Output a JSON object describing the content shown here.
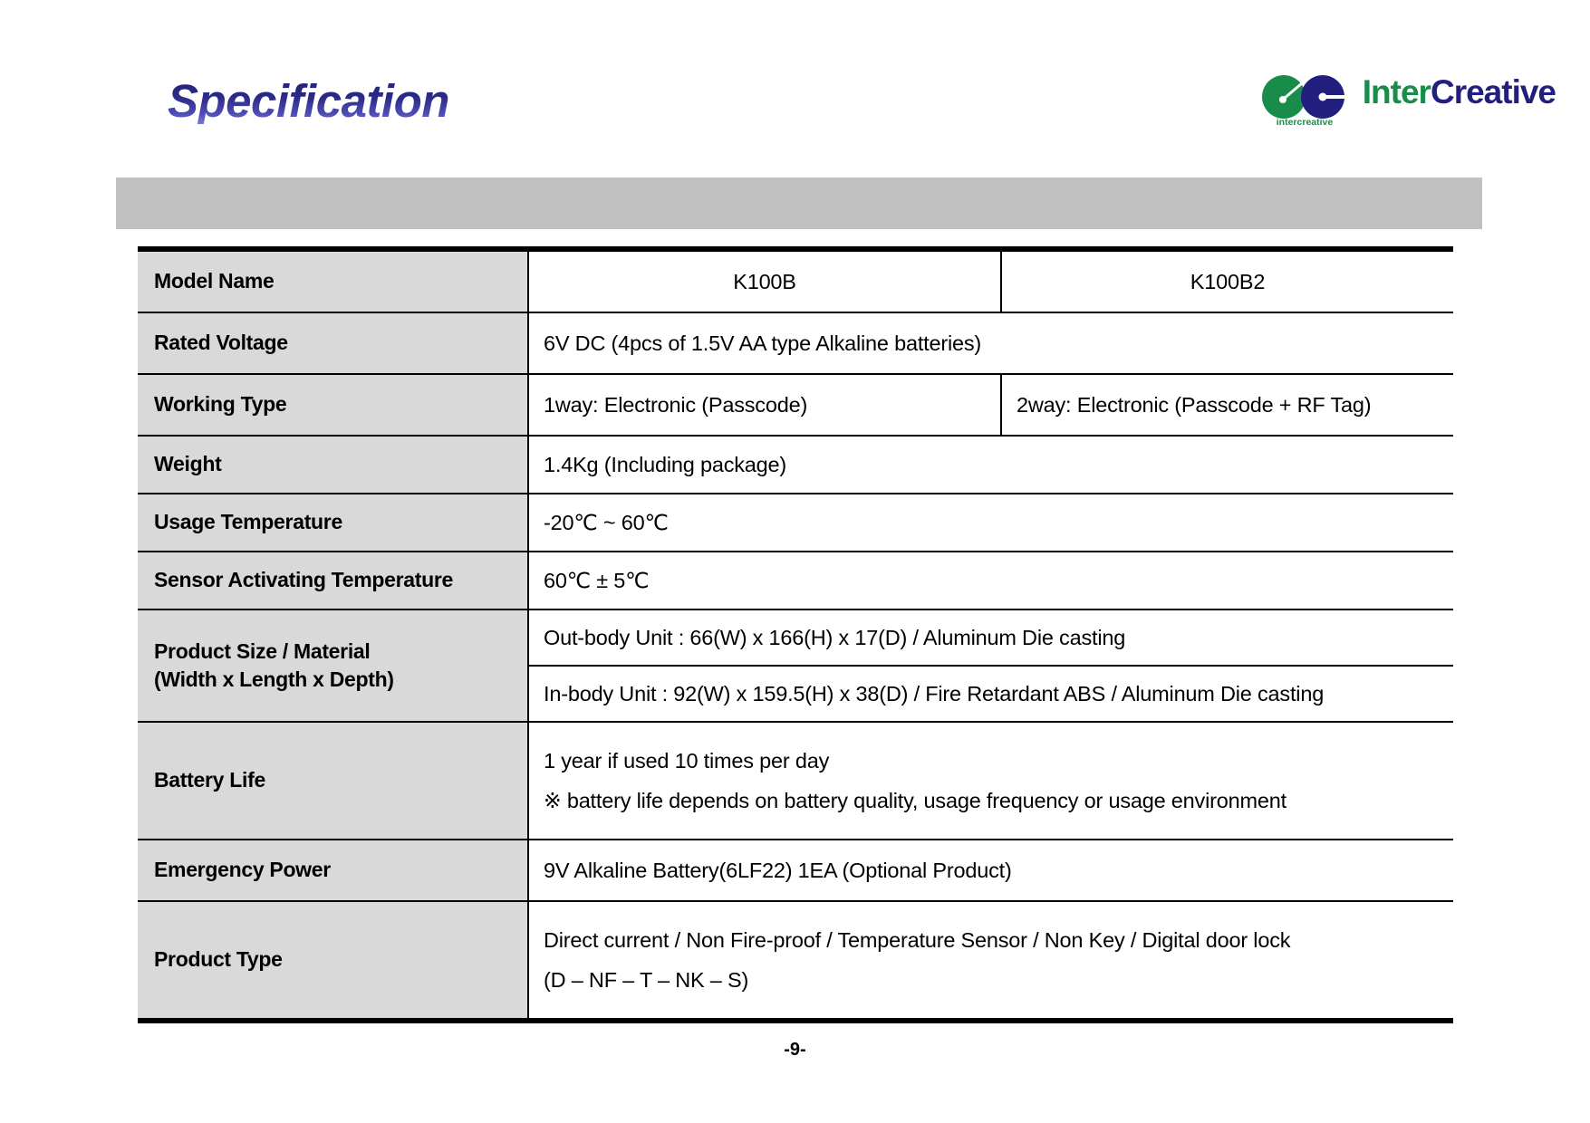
{
  "header": {
    "title": "Specification",
    "logo": {
      "mark_caption": "intercreative",
      "wordmark_part1": "Inter",
      "wordmark_part2": "Creative",
      "green": "#1a8c4a",
      "blue": "#221f7f"
    }
  },
  "banner": {
    "text": ""
  },
  "table": {
    "rows": [
      {
        "label": "Model Name",
        "value_left": "K100B",
        "value_right": "K100B2"
      },
      {
        "label": "Rated Voltage",
        "value": "6V DC (4pcs of 1.5V AA type Alkaline batteries)"
      },
      {
        "label": "Working Type",
        "value_left": "1way: Electronic (Passcode)",
        "value_right": "2way: Electronic (Passcode + RF Tag)"
      },
      {
        "label": "Weight",
        "value": "1.4Kg (Including package)"
      },
      {
        "label": "Usage Temperature",
        "value": "-20℃ ~ 60℃"
      },
      {
        "label": "Sensor Activating Temperature",
        "value": "60℃ ± 5℃"
      },
      {
        "label_line1": "Product Size / Material",
        "label_line2": "(Width x Length x Depth)",
        "value_row1": "Out-body Unit : 66(W) x 166(H) x 17(D) / Aluminum Die casting",
        "value_row2": "In-body Unit : 92(W) x 159.5(H) x 38(D) / Fire Retardant ABS / Aluminum Die casting"
      },
      {
        "label": "Battery Life",
        "value_line1": "1 year if used 10 times per day",
        "value_line2": "※ battery life depends on battery quality, usage frequency or usage environment"
      },
      {
        "label": "Emergency Power",
        "value": "9V Alkaline Battery(6LF22) 1EA (Optional Product)"
      },
      {
        "label": "Product Type",
        "value_line1": "Direct current / Non Fire-proof / Temperature Sensor / Non Key / Digital door lock",
        "value_line2": "(D – NF – T – NK – S)"
      }
    ]
  },
  "footer": {
    "page_number": "-9-"
  }
}
